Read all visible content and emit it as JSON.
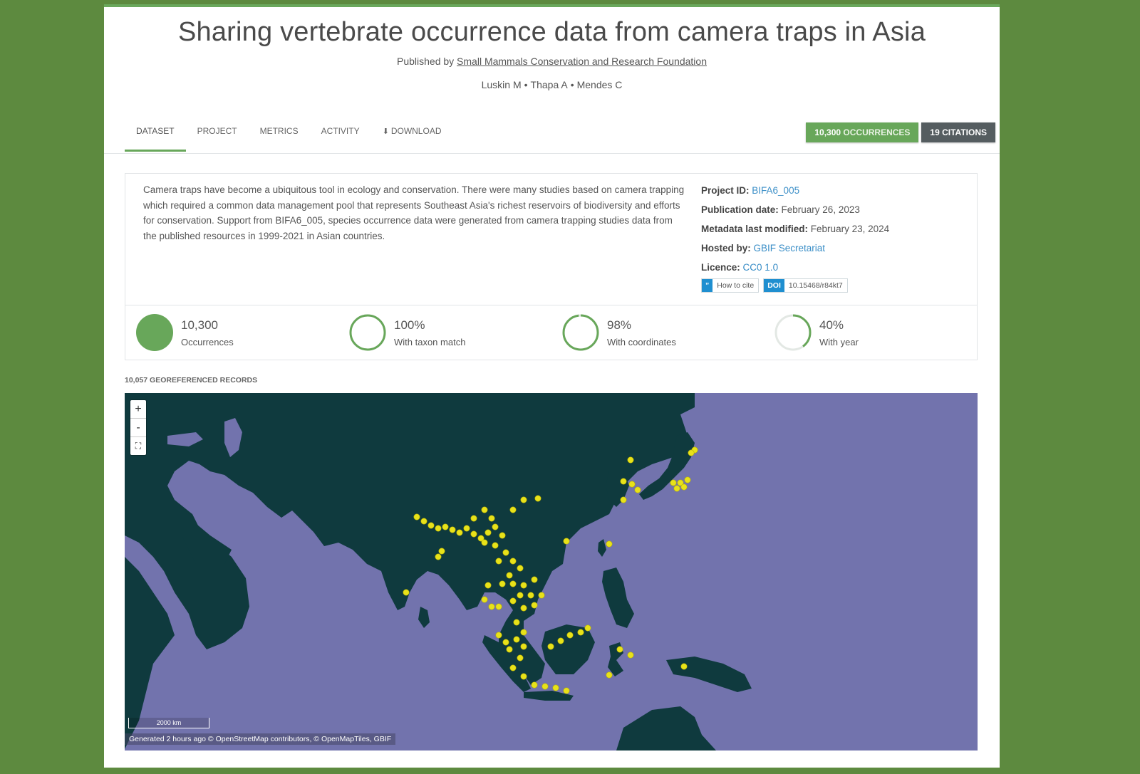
{
  "title": "Sharing vertebrate occurrence data from camera traps in Asia",
  "publisher": {
    "prefix": "Published by",
    "name": "Small Mammals Conservation and Research Foundation"
  },
  "authors": [
    "Luskin M",
    "Thapa A",
    "Mendes C"
  ],
  "tabs": [
    {
      "label": "Dataset",
      "active": true
    },
    {
      "label": "Project",
      "active": false
    },
    {
      "label": "Metrics",
      "active": false
    },
    {
      "label": "Activity",
      "active": false
    },
    {
      "label": "Download",
      "active": false
    }
  ],
  "badges": {
    "occurrences_count": "10,300",
    "occurrences_label": "OCCURRENCES",
    "citations": "19 CITATIONS"
  },
  "description": "Camera traps have become a ubiquitous tool in ecology and conservation. There were many studies based on camera trapping which required a common data management pool that represents Southeast Asia's richest reservoirs of biodiversity and efforts for conservation. Support from BIFA6_005, species occurrence data were generated from camera trapping studies data from the published resources in 1999-2021 in Asian countries.",
  "metadata": {
    "project_id_label": "Project ID:",
    "project_id": "BIFA6_005",
    "publication_date_label": "Publication date:",
    "publication_date": "February 26, 2023",
    "modified_label": "Metadata last modified:",
    "modified": "February 23, 2024",
    "hosted_label": "Hosted by:",
    "hosted_by": "GBIF Secretariat",
    "licence_label": "Licence:",
    "licence": "CC0 1.0",
    "cite_tag": "”",
    "cite_label": "How to cite",
    "doi_tag": "DOI",
    "doi": "10.15468/r84kt7"
  },
  "stats": [
    {
      "value": "10,300",
      "label": "Occurrences",
      "fraction": 1.0
    },
    {
      "value": "100%",
      "label": "With taxon match",
      "fraction": 1.0
    },
    {
      "value": "98%",
      "label": "With coordinates",
      "fraction": 0.98
    },
    {
      "value": "40%",
      "label": "With year",
      "fraction": 0.4
    }
  ],
  "map": {
    "georef_label": "10,057 GEOREFERENCED RECORDS",
    "zoom_in": "+",
    "zoom_out": "-",
    "fullscreen": "⛶",
    "scale_label": "2000 km",
    "attribution": "Generated 2 hours ago © OpenStreetMap contributors, © OpenMapTiles, GBIF",
    "ocean_color": "#7273ad",
    "land_color": "#0f3a3e",
    "point_color": "#e8e21a"
  },
  "colors": {
    "page_bg": "#5d8a3f",
    "accent_green": "#68a75a",
    "link_blue": "#3a8ec7",
    "citations_bg": "#555d60"
  }
}
